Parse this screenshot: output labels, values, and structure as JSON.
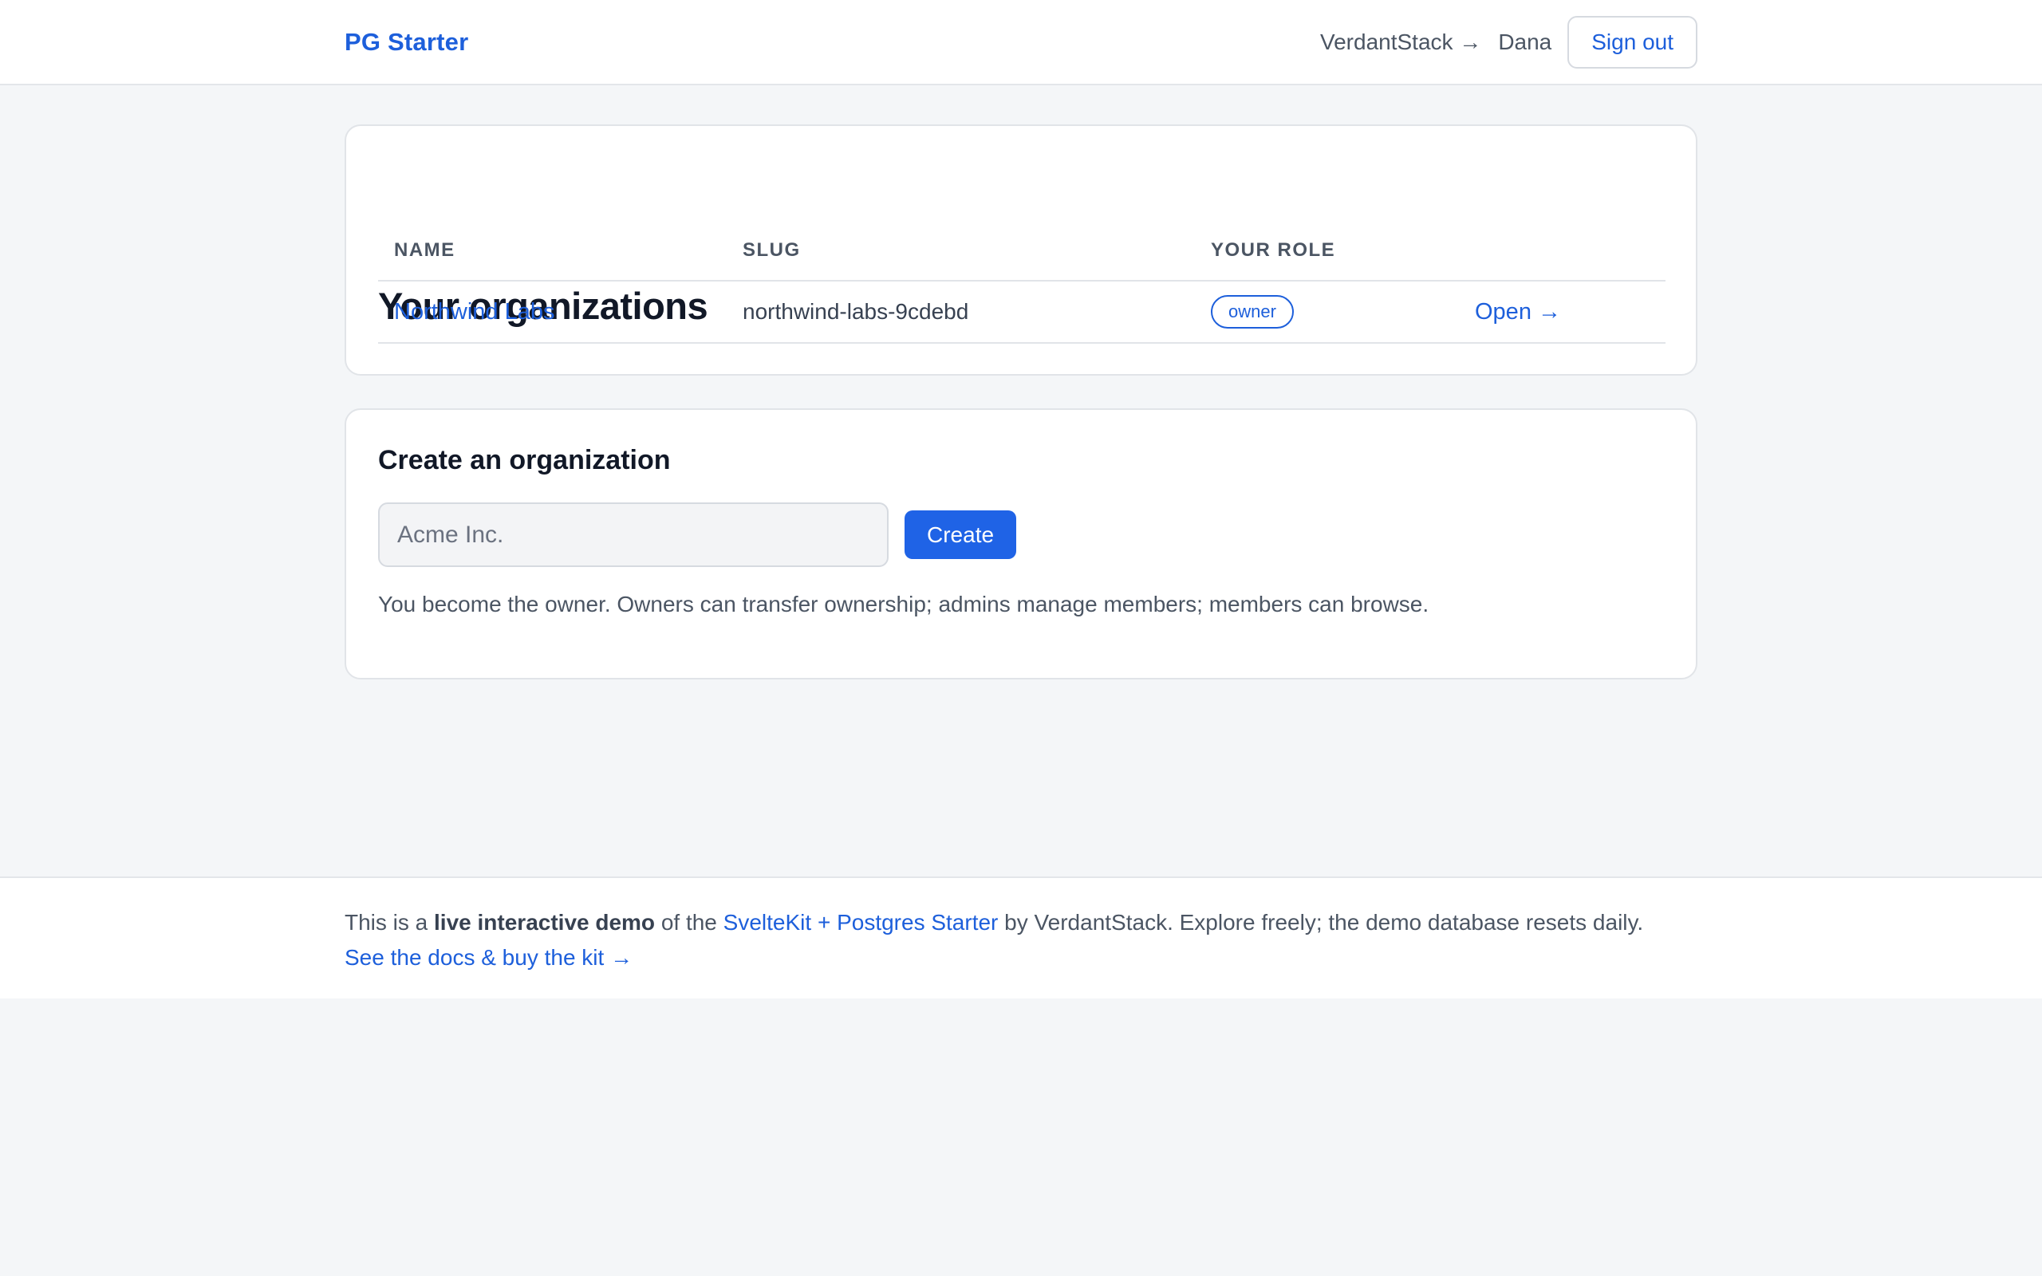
{
  "header": {
    "brand": "PG Starter",
    "org_link": "VerdantStack →",
    "user_name": "Dana",
    "signout_label": "Sign out"
  },
  "orgs_card": {
    "title": "Your organizations",
    "columns": [
      "NAME",
      "SLUG",
      "YOUR ROLE"
    ],
    "rows": [
      {
        "name": "Northwind Labs",
        "slug": "northwind-labs-9cdebd",
        "role": "owner",
        "action": "Open →"
      }
    ]
  },
  "create_card": {
    "title": "Create an organization",
    "input_placeholder": "Acme Inc.",
    "input_value": "",
    "create_label": "Create",
    "help_text": "You become the owner. Owners can transfer ownership; admins manage members; members can browse."
  },
  "footer": {
    "text_prefix": "This is a ",
    "text_bold": "live interactive demo",
    "text_middle": " of the ",
    "kit_link": "SvelteKit + Postgres Starter",
    "text_suffix": " by VerdantStack. Explore freely; the demo database resets daily.",
    "docs_link": "See the docs & buy the kit →"
  },
  "colors": {
    "accent": "#1d5fdb",
    "button_bg": "#1f63e6",
    "page_bg": "#f4f6f8"
  }
}
